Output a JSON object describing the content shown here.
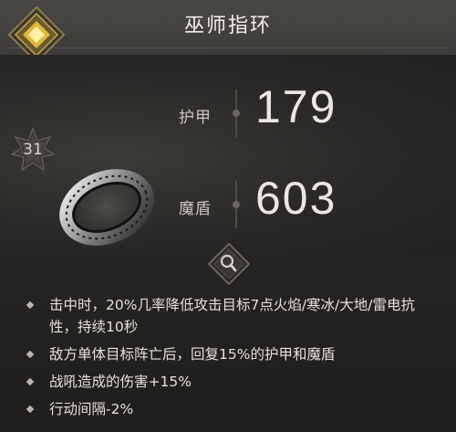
{
  "item": {
    "name": "巫师指环",
    "level": "31"
  },
  "stats": [
    {
      "label": "护甲",
      "value": "179"
    },
    {
      "label": "魔盾",
      "value": "603"
    }
  ],
  "effects": [
    "击中时，20%几率降低攻击目标7点火焰/寒冰/大地/雷电抗性，持续10秒",
    "敌方单体目标阵亡后，回复15%的护甲和魔盾",
    "战吼造成的伤害+15%",
    "行动间隔-2%"
  ],
  "icons": {
    "rarity": "diamond-rarity-icon",
    "level": "star-badge-icon",
    "inspect": "magnifier-icon",
    "item": "ring-icon"
  },
  "colors": {
    "rarity_gold": "#e2b93b",
    "text": "#e9e4dc"
  }
}
